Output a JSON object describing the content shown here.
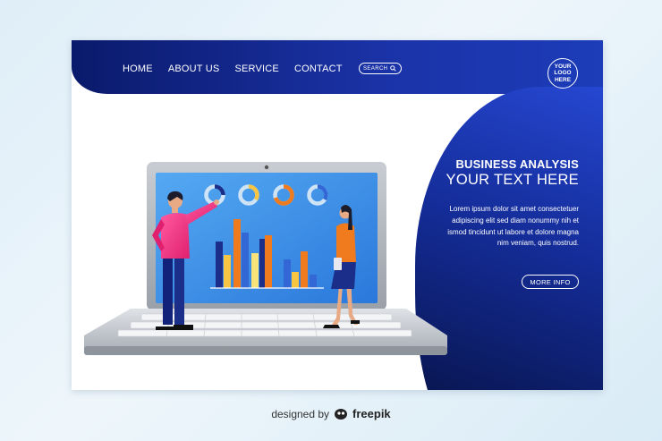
{
  "nav": {
    "items": [
      {
        "label": "HOME"
      },
      {
        "label": "ABOUT US"
      },
      {
        "label": "SERVICE"
      },
      {
        "label": "CONTACT"
      }
    ],
    "search_label": "SEARCH",
    "search_icon": "search-icon"
  },
  "logo": {
    "text": "YOUR LOGO HERE"
  },
  "hero": {
    "title": "BUSINESS ANALYSIS",
    "subtitle": "YOUR TEXT HERE",
    "body_lines": [
      "Lorem ipsum dolor sit amet consectetuer",
      "adipiscing elit sed diam nonummy nih et",
      "ismod tincidunt ut labore et dolore magna",
      "nim veniam, quis nostrud."
    ],
    "button_label": "MORE INFO"
  },
  "credit": {
    "prefix": "designed by",
    "brand": "freepik"
  },
  "colors": {
    "primary_dark": "#0a1a6b",
    "primary": "#1c3cb8",
    "screen": "#3a8ee6",
    "bar_navy": "#1b2f8a",
    "bar_orange": "#f07a1e",
    "bar_yellow": "#f6c544",
    "bar_blue": "#3467d6"
  }
}
